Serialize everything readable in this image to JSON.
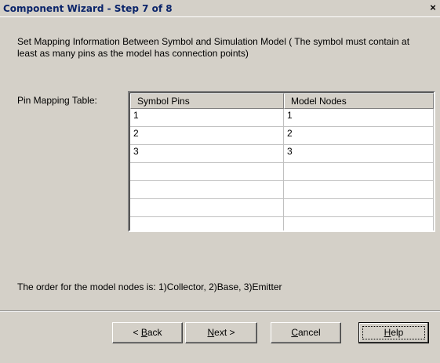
{
  "window": {
    "title": "Component Wizard - Step 7 of 8",
    "close_glyph": "×"
  },
  "instructions": "Set Mapping Information Between Symbol and Simulation Model ( The symbol must contain at least as many pins as the model has connection points)",
  "pin_mapping_label": "Pin Mapping Table:",
  "table": {
    "columns": [
      "Symbol Pins",
      "Model Nodes"
    ],
    "rows": [
      [
        "1",
        "1"
      ],
      [
        "2",
        "2"
      ],
      [
        "3",
        "3"
      ],
      [
        "",
        ""
      ],
      [
        "",
        ""
      ],
      [
        "",
        ""
      ],
      [
        "",
        ""
      ]
    ]
  },
  "order_text": "The order for the model nodes is: 1)Collector, 2)Base, 3)Emitter",
  "buttons": {
    "back": {
      "prefix": "< ",
      "mnemonic": "B",
      "rest": "ack"
    },
    "next": {
      "prefix": "",
      "mnemonic": "N",
      "rest": "ext >"
    },
    "cancel": {
      "prefix": "",
      "mnemonic": "C",
      "rest": "ancel"
    },
    "help": {
      "prefix": "",
      "mnemonic": "H",
      "rest": "elp"
    }
  }
}
